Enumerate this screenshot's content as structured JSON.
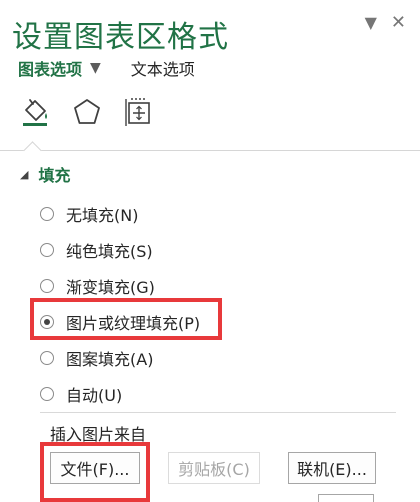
{
  "pane": {
    "title": "设置图表区格式",
    "controls": {
      "dropdown_icon": "chevron-down-icon",
      "close_icon": "close-icon"
    }
  },
  "tabs": {
    "chart_options": "图表选项",
    "text_options": "文本选项"
  },
  "icons": [
    "fill-line-icon",
    "effects-pentagon-icon",
    "size-properties-icon"
  ],
  "fill_section": {
    "title": "填充",
    "options": [
      {
        "label": "无填充(N)",
        "checked": false
      },
      {
        "label": "纯色填充(S)",
        "checked": false
      },
      {
        "label": "渐变填充(G)",
        "checked": false
      },
      {
        "label": "图片或纹理填充(P)",
        "checked": true
      },
      {
        "label": "图案填充(A)",
        "checked": false
      },
      {
        "label": "自动(U)",
        "checked": false
      }
    ]
  },
  "insert_from": {
    "label": "插入图片来自",
    "file_button": "文件(F)...",
    "clipboard_button": "剪贴板(C)",
    "online_button": "联机(E)..."
  },
  "colors": {
    "accent": "#217346",
    "highlight": "#e8393b"
  }
}
